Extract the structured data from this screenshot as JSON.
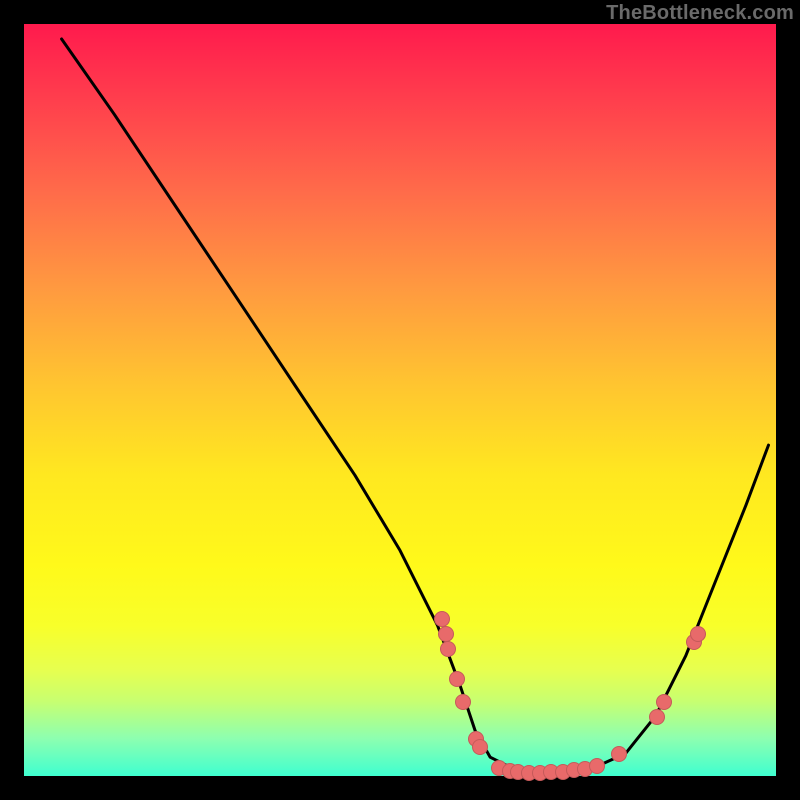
{
  "watermark": "TheBottleneck.com",
  "chart_data": {
    "type": "line",
    "title": "",
    "xlabel": "",
    "ylabel": "",
    "xlim": [
      0,
      100
    ],
    "ylim": [
      0,
      100
    ],
    "grid": false,
    "background_gradient": [
      "#ff1a4d",
      "#ffe820",
      "#3fffd0"
    ],
    "curve": {
      "description": "V-shaped bottleneck curve with flat valley",
      "type": "polyline",
      "points_xy": [
        [
          5,
          98
        ],
        [
          12,
          88
        ],
        [
          20,
          76
        ],
        [
          28,
          64
        ],
        [
          36,
          52
        ],
        [
          44,
          40
        ],
        [
          50,
          30
        ],
        [
          55,
          20
        ],
        [
          58,
          12
        ],
        [
          60,
          6
        ],
        [
          62,
          2.5
        ],
        [
          65,
          1
        ],
        [
          68,
          0.5
        ],
        [
          72,
          0.5
        ],
        [
          76,
          1.2
        ],
        [
          80,
          3
        ],
        [
          84,
          8
        ],
        [
          88,
          16
        ],
        [
          92,
          26
        ],
        [
          96,
          36
        ],
        [
          99,
          44
        ]
      ]
    },
    "markers": {
      "color": "#e86a6a",
      "points_xy": [
        [
          55.5,
          21
        ],
        [
          56.0,
          19
        ],
        [
          56.3,
          17
        ],
        [
          57.5,
          13
        ],
        [
          58.2,
          10
        ],
        [
          60.0,
          5
        ],
        [
          60.5,
          4
        ],
        [
          63.0,
          1.2
        ],
        [
          64.5,
          0.8
        ],
        [
          65.5,
          0.6
        ],
        [
          67.0,
          0.5
        ],
        [
          68.5,
          0.5
        ],
        [
          70.0,
          0.6
        ],
        [
          71.5,
          0.7
        ],
        [
          73.0,
          0.9
        ],
        [
          74.5,
          1.1
        ],
        [
          76.0,
          1.5
        ],
        [
          79.0,
          3
        ],
        [
          84.0,
          8
        ],
        [
          85.0,
          10
        ],
        [
          89.0,
          18
        ],
        [
          89.5,
          19
        ]
      ]
    }
  }
}
